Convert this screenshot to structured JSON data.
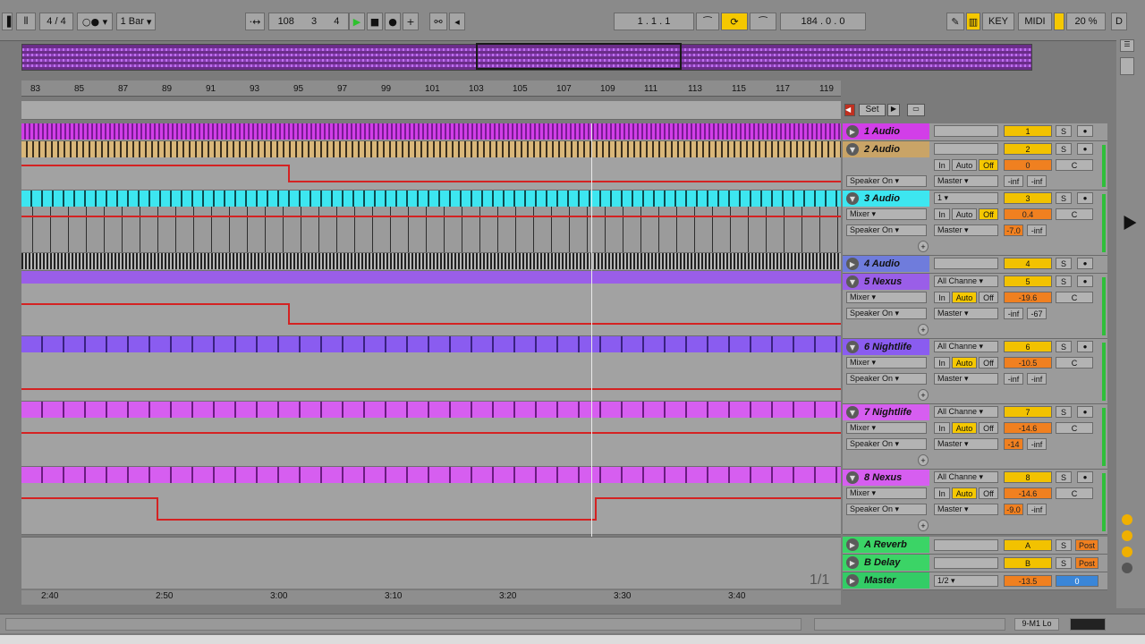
{
  "transport": {
    "sig_num": "4",
    "sig_den": "4",
    "quant": "1 Bar",
    "tempo_int": "108",
    "pos1": "3",
    "pos2": "4",
    "arr_pos": "1 .  1 .  1",
    "loop_len": "184 .  0 .  0",
    "key": "KEY",
    "midi": "MIDI",
    "cpu": "20 %",
    "d": "D"
  },
  "set_button": "Set",
  "ruler": [
    "83",
    "85",
    "87",
    "89",
    "91",
    "93",
    "95",
    "97",
    "99",
    "101",
    "103",
    "105",
    "107",
    "109",
    "111",
    "113",
    "115",
    "117",
    "119"
  ],
  "tracks": [
    {
      "name": "1 Audio",
      "color": "#d23ee8",
      "num": "1",
      "s": "S"
    },
    {
      "name": "2 Audio",
      "color": "#c9a467",
      "num": "2",
      "s": "S",
      "in": "In",
      "auto": "Auto",
      "off": "Off",
      "route": "Speaker On",
      "out": "Master",
      "vol": "0",
      "pan": "C",
      "inf1": "-inf",
      "inf2": "-inf"
    },
    {
      "name": "3 Audio",
      "color": "#3de6f0",
      "num": "3",
      "s": "S",
      "input": "1",
      "in": "In",
      "auto": "Auto",
      "off": "Off",
      "mixer": "Mixer",
      "route": "Speaker On",
      "out": "Master",
      "vol": "0.4",
      "pan": "C",
      "db": "-7.0",
      "inf2": "-inf"
    },
    {
      "name": "4 Audio",
      "color": "#6f7cdc",
      "num": "4",
      "s": "S"
    },
    {
      "name": "5 Nexus",
      "color": "#9a5ee8",
      "num": "5",
      "s": "S",
      "input": "All Channe",
      "in": "In",
      "auto": "Auto",
      "off": "Off",
      "mixer": "Mixer",
      "route": "Speaker On",
      "out": "Master",
      "vol": "-19.6",
      "pan": "C",
      "inf1": "-inf",
      "db2": "-67"
    },
    {
      "name": "6 Nightlife",
      "color": "#8a5cf0",
      "num": "6",
      "s": "S",
      "input": "All Channe",
      "in": "In",
      "auto": "Auto",
      "off": "Off",
      "mixer": "Mixer",
      "route": "Speaker On",
      "out": "Master",
      "vol": "-10.5",
      "pan": "C",
      "inf1": "-inf",
      "inf2": "-inf"
    },
    {
      "name": "7 Nightlife",
      "color": "#d65ef0",
      "num": "7",
      "s": "S",
      "input": "All Channe",
      "in": "In",
      "auto": "Auto",
      "off": "Off",
      "mixer": "Mixer",
      "route": "Speaker On",
      "out": "Master",
      "vol": "-14.6",
      "pan": "C",
      "db": "-14",
      "inf2": "-inf"
    },
    {
      "name": "8 Nexus",
      "color": "#d65ef0",
      "num": "8",
      "s": "S",
      "input": "All Channe",
      "in": "In",
      "auto": "Auto",
      "off": "Off",
      "mixer": "Mixer",
      "route": "Speaker On",
      "out": "Master",
      "vol": "-14.6",
      "pan": "C",
      "db": "-9.0",
      "inf2": "-inf"
    }
  ],
  "returns": [
    {
      "name": "A Reverb",
      "num": "A",
      "s": "S",
      "post": "Post"
    },
    {
      "name": "B Delay",
      "num": "B",
      "s": "S",
      "post": "Post"
    },
    {
      "name": "Master",
      "input": "1/2",
      "num": "-13.5",
      "vol": "0"
    }
  ],
  "page_indicator": "1/1",
  "timeline": [
    "2:40",
    "2:50",
    "3:00",
    "3:10",
    "3:20",
    "3:30",
    "3:40"
  ],
  "status_right": "9-M1 Lo",
  "colors": {
    "accent": "#f5c800",
    "automation": "#d42222",
    "meter": "#2fbf3a"
  }
}
